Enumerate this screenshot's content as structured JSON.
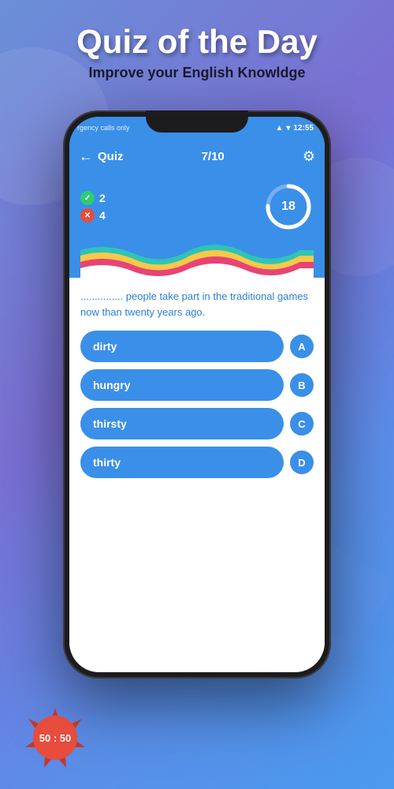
{
  "page": {
    "background": "linear-gradient(135deg, #6a8fd8, #7b6fd4, #5b8de8, #4a9af0)"
  },
  "header": {
    "main_title": "Quiz of the Day",
    "sub_title": "Improve your English Knowldge"
  },
  "status_bar": {
    "left_text": "rgency calls only",
    "time": "12:55",
    "signal_icon": "signal-icon",
    "wifi_icon": "wifi-icon",
    "battery_icon": "battery-icon"
  },
  "quiz_header": {
    "back_label": "Quiz",
    "back_icon": "back-arrow-icon",
    "progress": "7/10",
    "settings_icon": "settings-gear-icon"
  },
  "score_panel": {
    "correct_count": "2",
    "incorrect_count": "4",
    "correct_icon": "checkmark-icon",
    "incorrect_icon": "x-mark-icon",
    "timer_value": "18"
  },
  "question": {
    "text": "............... people take part in the traditional games now than twenty years ago."
  },
  "answers": [
    {
      "id": "A",
      "label": "dirty"
    },
    {
      "id": "B",
      "label": "hungry"
    },
    {
      "id": "C",
      "label": "thirsty"
    },
    {
      "id": "D",
      "label": "thirty"
    }
  ],
  "fifty_fifty": {
    "label": "50 : 50"
  }
}
